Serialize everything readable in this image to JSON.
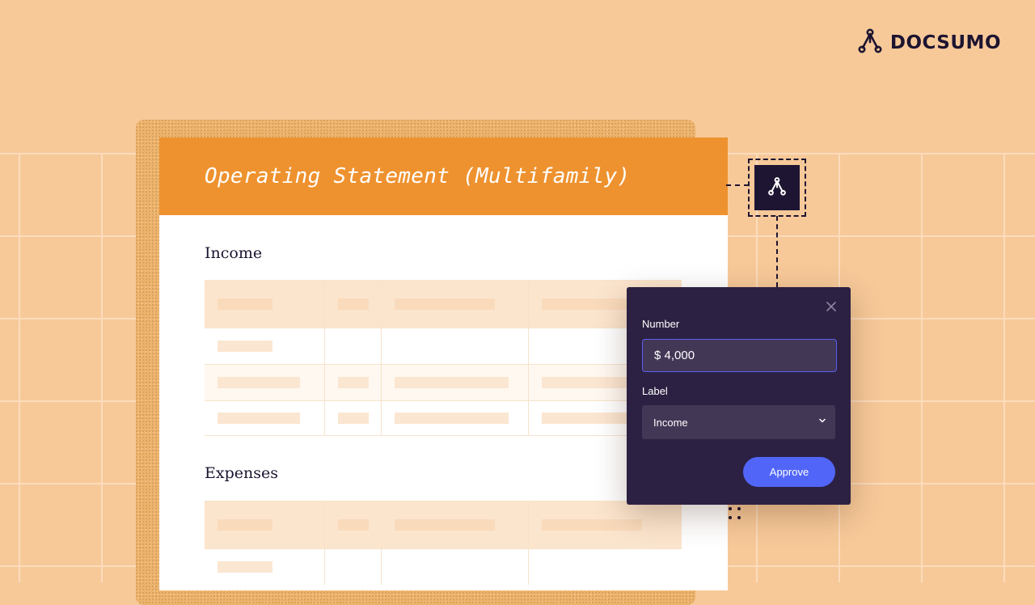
{
  "brand": {
    "name": "DOCSUMO",
    "logo_icon": "docsumo-logo-icon",
    "color": "#1d1430"
  },
  "colors": {
    "background": "#f7c999",
    "header": "#ee922f",
    "popup": "#2c2142",
    "accent": "#5166f8",
    "input_border": "#5a5ef0"
  },
  "document": {
    "title": "Operating Statement (Multifamily)",
    "sections": [
      {
        "title": "Income"
      },
      {
        "title": "Expenses"
      }
    ]
  },
  "popup": {
    "close_icon": "close-icon",
    "number_label": "Number",
    "number_value": "$ 4,000",
    "label_label": "Label",
    "label_value": "Income",
    "dropdown_icon": "chevron-down-icon",
    "approve_label": "Approve"
  }
}
